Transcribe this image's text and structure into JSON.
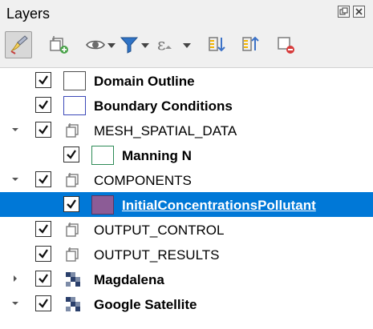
{
  "panel": {
    "title": "Layers",
    "float_button_icon": "float-icon",
    "close_button_icon": "close-icon"
  },
  "toolbar": {
    "items": [
      "style-layer-icon",
      "add-group-icon",
      "visibility-icon",
      "filter-icon",
      "expression-filter-icon",
      "expand-all-icon",
      "collapse-all-icon",
      "remove-layer-icon"
    ]
  },
  "tree": {
    "items": [
      {
        "label": "Domain Outline",
        "checked": true,
        "type": "polygon-outline",
        "bold": true,
        "expander": "none"
      },
      {
        "label": "Boundary Conditions",
        "checked": true,
        "type": "polygon-blue-outline",
        "bold": true,
        "expander": "none"
      },
      {
        "label": "MESH_SPATIAL_DATA",
        "checked": true,
        "type": "group",
        "bold": false,
        "expander": "expanded"
      },
      {
        "label": "Manning N",
        "checked": true,
        "type": "polygon-green-outline",
        "bold": true,
        "expander": "none"
      },
      {
        "label": "COMPONENTS",
        "checked": true,
        "type": "group",
        "bold": false,
        "expander": "expanded"
      },
      {
        "label": "InitialConcentrationsPollutant",
        "checked": true,
        "type": "polygon-purple-fill",
        "bold": true,
        "selected": true,
        "expander": "none"
      },
      {
        "label": "OUTPUT_CONTROL",
        "checked": true,
        "type": "group",
        "bold": false,
        "expander": "none"
      },
      {
        "label": "OUTPUT_RESULTS",
        "checked": true,
        "type": "group",
        "bold": false,
        "expander": "none"
      },
      {
        "label": "Magdalena",
        "checked": true,
        "type": "raster",
        "bold": true,
        "expander": "collapsed"
      },
      {
        "label": "Google Satellite",
        "checked": true,
        "type": "raster",
        "bold": true,
        "expander": "expanded"
      }
    ]
  },
  "colors": {
    "selection": "#0078d7",
    "purple_fill": "#8c5c96",
    "green_outline": "#2e8b57",
    "blue_outline": "#3b49b8"
  }
}
